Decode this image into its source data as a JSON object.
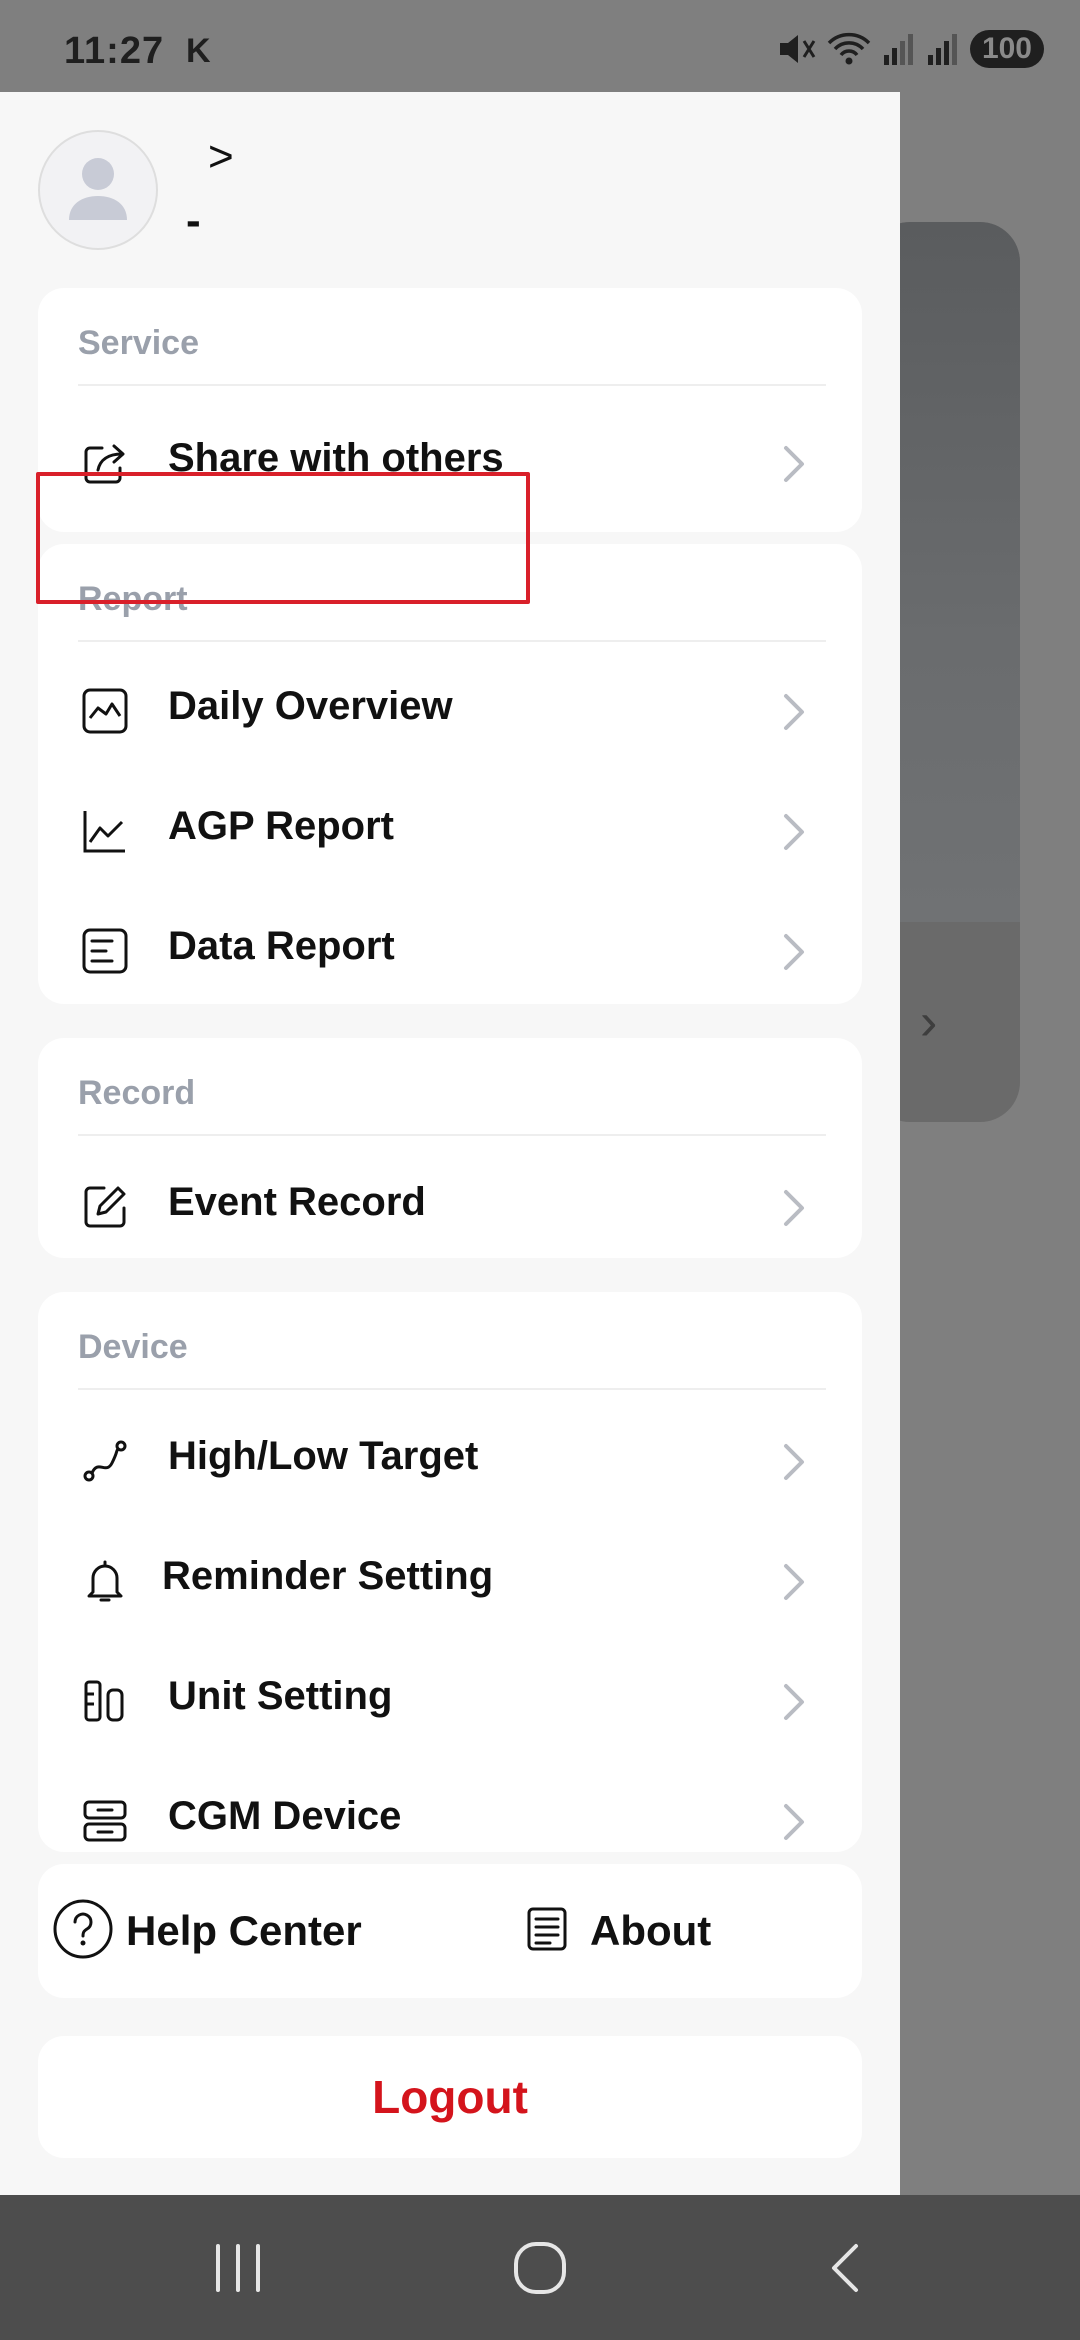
{
  "status_bar": {
    "time": "11:27",
    "carrier_letter": "K",
    "battery": "100",
    "icons": [
      "mute-icon",
      "wifi-icon",
      "signal-icon",
      "signal-icon",
      "battery-icon"
    ]
  },
  "profile": {
    "chevron": ">",
    "subtitle": "-",
    "avatar_icon": "user-avatar-icon"
  },
  "sections": {
    "service": {
      "header": "Service",
      "items": [
        {
          "label": "Share with others",
          "icon": "share-icon"
        }
      ]
    },
    "report": {
      "header": "Report",
      "items": [
        {
          "label": "Daily Overview",
          "icon": "daily-chart-icon"
        },
        {
          "label": "AGP Report",
          "icon": "line-chart-icon"
        },
        {
          "label": "Data Report",
          "icon": "document-list-icon"
        }
      ]
    },
    "record": {
      "header": "Record",
      "items": [
        {
          "label": "Event Record",
          "icon": "edit-icon"
        }
      ]
    },
    "device": {
      "header": "Device",
      "items": [
        {
          "label": "High/Low Target",
          "icon": "curve-icon"
        },
        {
          "label": "Reminder Setting",
          "icon": "bell-icon"
        },
        {
          "label": "Unit Setting",
          "icon": "unit-icon"
        },
        {
          "label": "CGM Device",
          "icon": "device-icon"
        }
      ]
    }
  },
  "bottom_links": {
    "help": "Help Center",
    "about": "About"
  },
  "logout": "Logout",
  "colors": {
    "accent_red": "#d4141c",
    "highlight_red": "#d9202a",
    "section_header": "#9aa0ab"
  }
}
